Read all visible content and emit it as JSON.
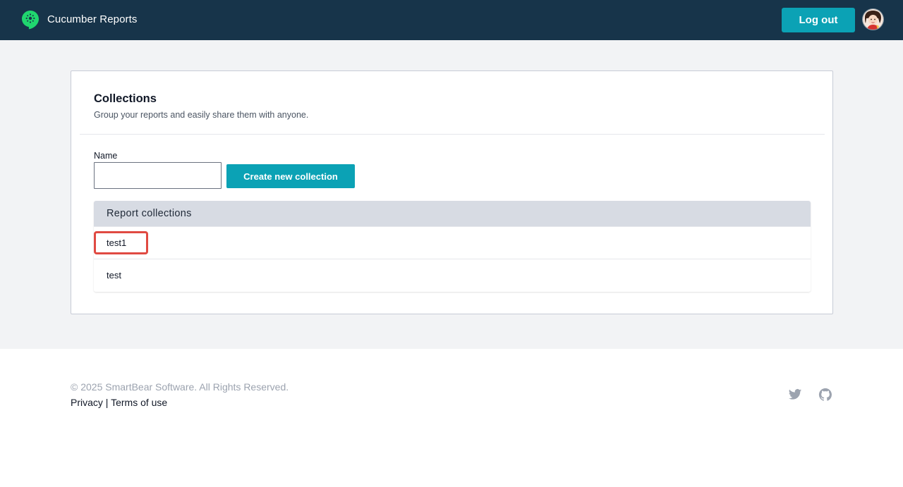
{
  "header": {
    "title": "Cucumber Reports",
    "logout_label": "Log out",
    "logo_icon": "cucumber-logo-icon",
    "avatar_icon": "user-avatar"
  },
  "collections": {
    "title": "Collections",
    "subtitle": "Group your reports and easily share them with anyone.",
    "name_label": "Name",
    "name_value": "",
    "create_label": "Create new collection",
    "table_header": "Report collections",
    "items": [
      {
        "label": "test1"
      },
      {
        "label": "test"
      }
    ]
  },
  "footer": {
    "copyright": "© 2025 SmartBear Software. All Rights Reserved.",
    "privacy_label": "Privacy",
    "separator": "|",
    "terms_label": "Terms of use",
    "social_icons": [
      "twitter-icon",
      "github-icon"
    ]
  },
  "colors": {
    "header_bg": "#17344a",
    "accent": "#0ba2b5",
    "page_bg": "#f2f3f5",
    "table_header_bg": "#d7dbe3",
    "highlight": "#e04a42"
  }
}
